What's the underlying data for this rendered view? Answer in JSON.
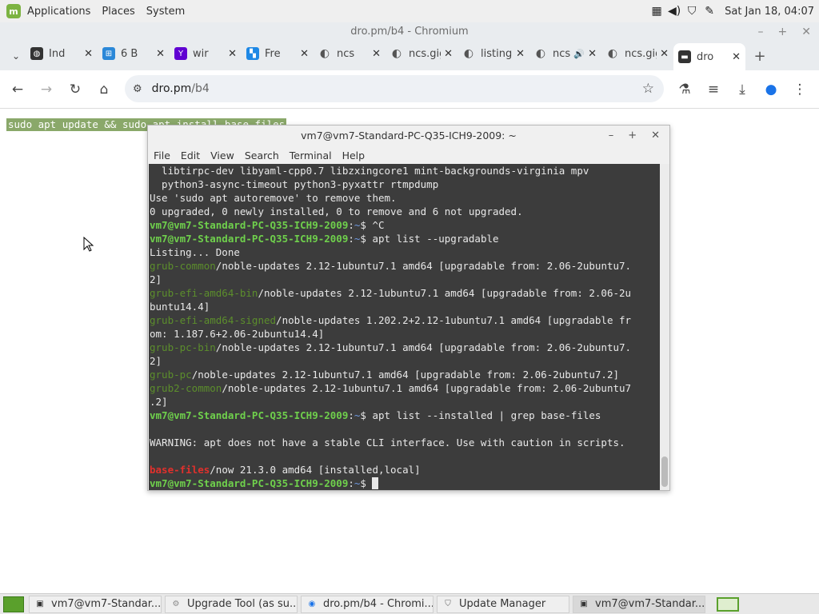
{
  "panel": {
    "menus": [
      "Applications",
      "Places",
      "System"
    ],
    "clock": "Sat Jan 18, 04:07"
  },
  "browser": {
    "window_title": "dro.pm/b4 - Chromium",
    "tabs": [
      {
        "label": "Ind",
        "icon": "github-icon"
      },
      {
        "label": "6 B",
        "icon": "page-icon"
      },
      {
        "label": "wir",
        "icon": "yahoo-icon"
      },
      {
        "label": "Fre",
        "icon": "stack-icon"
      },
      {
        "label": "ncs",
        "icon": "globe-icon"
      },
      {
        "label": "ncs.gig",
        "icon": "globe-icon"
      },
      {
        "label": "listing",
        "icon": "globe-icon"
      },
      {
        "label": "ncs",
        "icon": "globe-icon",
        "audio": true
      },
      {
        "label": "ncs.gig",
        "icon": "globe-icon"
      },
      {
        "label": "dro",
        "icon": "terminal-icon",
        "active": true
      }
    ],
    "url_host": "dro.pm",
    "url_path": "/b4"
  },
  "page": {
    "selected_text": "sudo apt update && sudo apt install base-files"
  },
  "terminal": {
    "title": "vm7@vm7-Standard-PC-Q35-ICH9-2009: ~",
    "menu": [
      "File",
      "Edit",
      "View",
      "Search",
      "Terminal",
      "Help"
    ],
    "prompt_user": "vm7@vm7-Standard-PC-Q35-ICH9-2009",
    "lines": [
      {
        "t": "text",
        "v": "  libtirpc-dev libyaml-cpp0.7 libzxingcore1 mint-backgrounds-virginia mpv"
      },
      {
        "t": "text",
        "v": "  python3-async-timeout python3-pyxattr rtmpdump"
      },
      {
        "t": "text",
        "v": "Use 'sudo apt autoremove' to remove them."
      },
      {
        "t": "text",
        "v": "0 upgraded, 0 newly installed, 0 to remove and 6 not upgraded."
      },
      {
        "t": "prompt",
        "v": " ^C"
      },
      {
        "t": "prompt",
        "v": " apt list --upgradable"
      },
      {
        "t": "text",
        "v": "Listing... Done"
      },
      {
        "t": "pkg",
        "name": "grub-common",
        "v": "/noble-updates 2.12-1ubuntu7.1 amd64 [upgradable from: 2.06-2ubuntu7."
      },
      {
        "t": "text",
        "v": "2]"
      },
      {
        "t": "pkg",
        "name": "grub-efi-amd64-bin",
        "v": "/noble-updates 2.12-1ubuntu7.1 amd64 [upgradable from: 2.06-2u"
      },
      {
        "t": "text",
        "v": "buntu14.4]"
      },
      {
        "t": "pkg",
        "name": "grub-efi-amd64-signed",
        "v": "/noble-updates 1.202.2+2.12-1ubuntu7.1 amd64 [upgradable fr"
      },
      {
        "t": "text",
        "v": "om: 1.187.6+2.06-2ubuntu14.4]"
      },
      {
        "t": "pkg",
        "name": "grub-pc-bin",
        "v": "/noble-updates 2.12-1ubuntu7.1 amd64 [upgradable from: 2.06-2ubuntu7."
      },
      {
        "t": "text",
        "v": "2]"
      },
      {
        "t": "pkg",
        "name": "grub-pc",
        "v": "/noble-updates 2.12-1ubuntu7.1 amd64 [upgradable from: 2.06-2ubuntu7.2]"
      },
      {
        "t": "pkg",
        "name": "grub2-common",
        "v": "/noble-updates 2.12-1ubuntu7.1 amd64 [upgradable from: 2.06-2ubuntu7"
      },
      {
        "t": "text",
        "v": ".2]"
      },
      {
        "t": "prompt",
        "v": " apt list --installed | grep base-files"
      },
      {
        "t": "text",
        "v": ""
      },
      {
        "t": "text",
        "v": "WARNING: apt does not have a stable CLI interface. Use with caution in scripts."
      },
      {
        "t": "text",
        "v": ""
      },
      {
        "t": "hl",
        "name": "base-files",
        "v": "/now 21.3.0 amd64 [installed,local]"
      },
      {
        "t": "prompt",
        "v": " "
      }
    ]
  },
  "taskbar": {
    "items": [
      {
        "label": "vm7@vm7-Standar...",
        "icon": "terminal-icon"
      },
      {
        "label": "Upgrade Tool (as su...",
        "icon": "upgrade-icon"
      },
      {
        "label": "dro.pm/b4 - Chromi...",
        "icon": "chromium-icon"
      },
      {
        "label": "Update Manager",
        "icon": "shield-icon"
      },
      {
        "label": "vm7@vm7-Standar...",
        "icon": "terminal-icon",
        "active": true
      }
    ]
  }
}
